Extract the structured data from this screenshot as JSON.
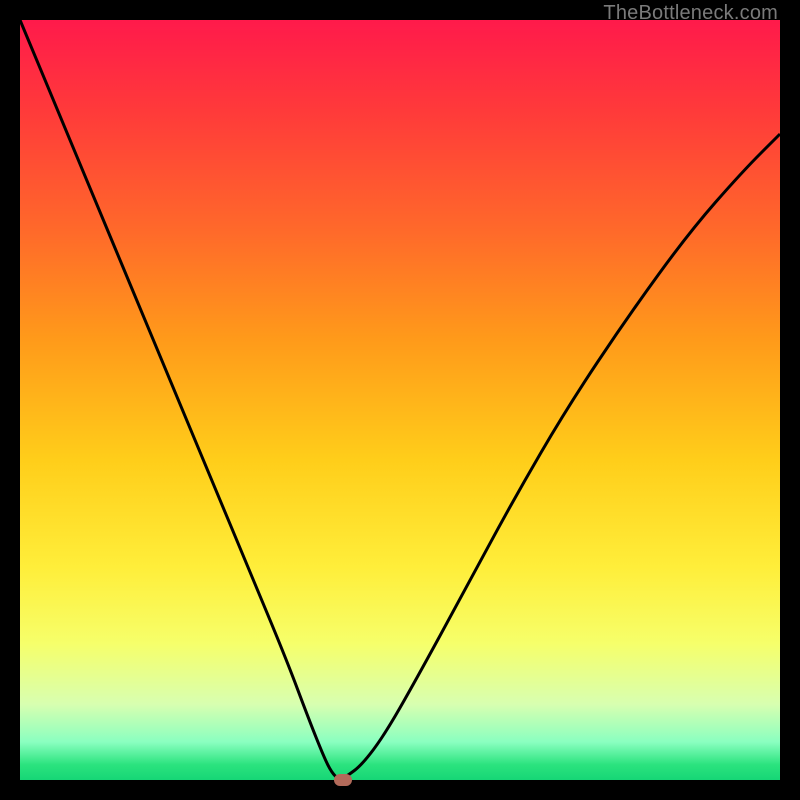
{
  "watermark": "TheBottleneck.com",
  "chart_data": {
    "type": "line",
    "title": "",
    "xlabel": "",
    "ylabel": "",
    "xlim": [
      0,
      100
    ],
    "ylim": [
      0,
      100
    ],
    "x": [
      0,
      5,
      10,
      15,
      20,
      25,
      30,
      35,
      38,
      40,
      41,
      42,
      43,
      45,
      48,
      52,
      58,
      65,
      72,
      80,
      88,
      95,
      100
    ],
    "y": [
      100,
      88,
      76,
      64,
      52,
      40,
      28,
      16,
      8,
      3,
      1,
      0,
      0.5,
      2,
      6,
      13,
      24,
      37,
      49,
      61,
      72,
      80,
      85
    ],
    "marker": {
      "x": 42.5,
      "y": 0
    },
    "notes": "V-shaped bottleneck curve over rainbow gradient; minimum near x≈42."
  },
  "colors": {
    "curve": "#000000",
    "marker": "#b36a5a",
    "frame": "#000000"
  }
}
